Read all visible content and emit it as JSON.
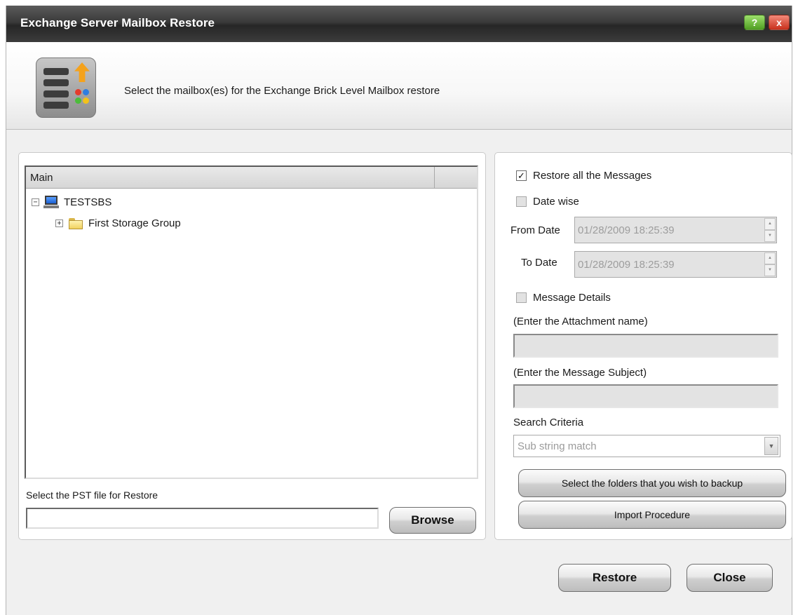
{
  "window": {
    "title": "Exchange Server Mailbox Restore",
    "help_glyph": "?",
    "close_glyph": "x"
  },
  "banner": {
    "instruction": "Select the mailbox(es) for the Exchange Brick Level Mailbox restore",
    "icon": "server-restore-icon"
  },
  "tree": {
    "column_header": "Main",
    "items": [
      {
        "label": "TESTSBS",
        "expander": "−",
        "icon": "computer-icon"
      },
      {
        "label": "First Storage Group",
        "expander": "+",
        "icon": "folder-icon"
      }
    ]
  },
  "pst": {
    "label": "Select the PST file for Restore",
    "value": "",
    "browse_label": "Browse"
  },
  "options": {
    "restore_all": {
      "label": "Restore all the Messages",
      "checked": true
    },
    "date_wise": {
      "label": "Date wise",
      "checked": false
    },
    "from_date": {
      "label": "From Date",
      "value": "01/28/2009 18:25:39"
    },
    "to_date": {
      "label": "To Date",
      "value": "01/28/2009 18:25:39"
    },
    "message_details": {
      "label": "Message Details",
      "checked": false
    },
    "attachment_label": "(Enter the Attachment name)",
    "attachment_value": "",
    "subject_label": "(Enter the Message Subject)",
    "subject_value": "",
    "search_criteria_label": "Search Criteria",
    "search_criteria_value": "Sub string match",
    "select_folders_label": "Select the folders that you wish to backup",
    "import_label": "Import Procedure"
  },
  "footer": {
    "restore_label": "Restore",
    "close_label": "Close"
  },
  "check_glyph": "✓",
  "colors": {
    "titlebar": "#333333",
    "help_button": "#5fb030",
    "close_button": "#d9452f"
  }
}
